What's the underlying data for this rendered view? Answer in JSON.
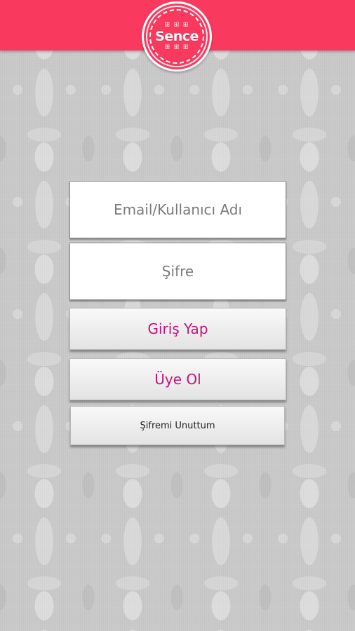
{
  "header": {
    "logo_text": "Sence",
    "brand_color": "#f93a5e"
  },
  "login": {
    "email_placeholder": "Email/Kullanıcı Adı",
    "password_placeholder": "Şifre",
    "login_label": "Giriş Yap",
    "register_label": "Üye Ol",
    "forgot_label": "Şifremi Unuttum",
    "accent_color": "#c1137a"
  }
}
